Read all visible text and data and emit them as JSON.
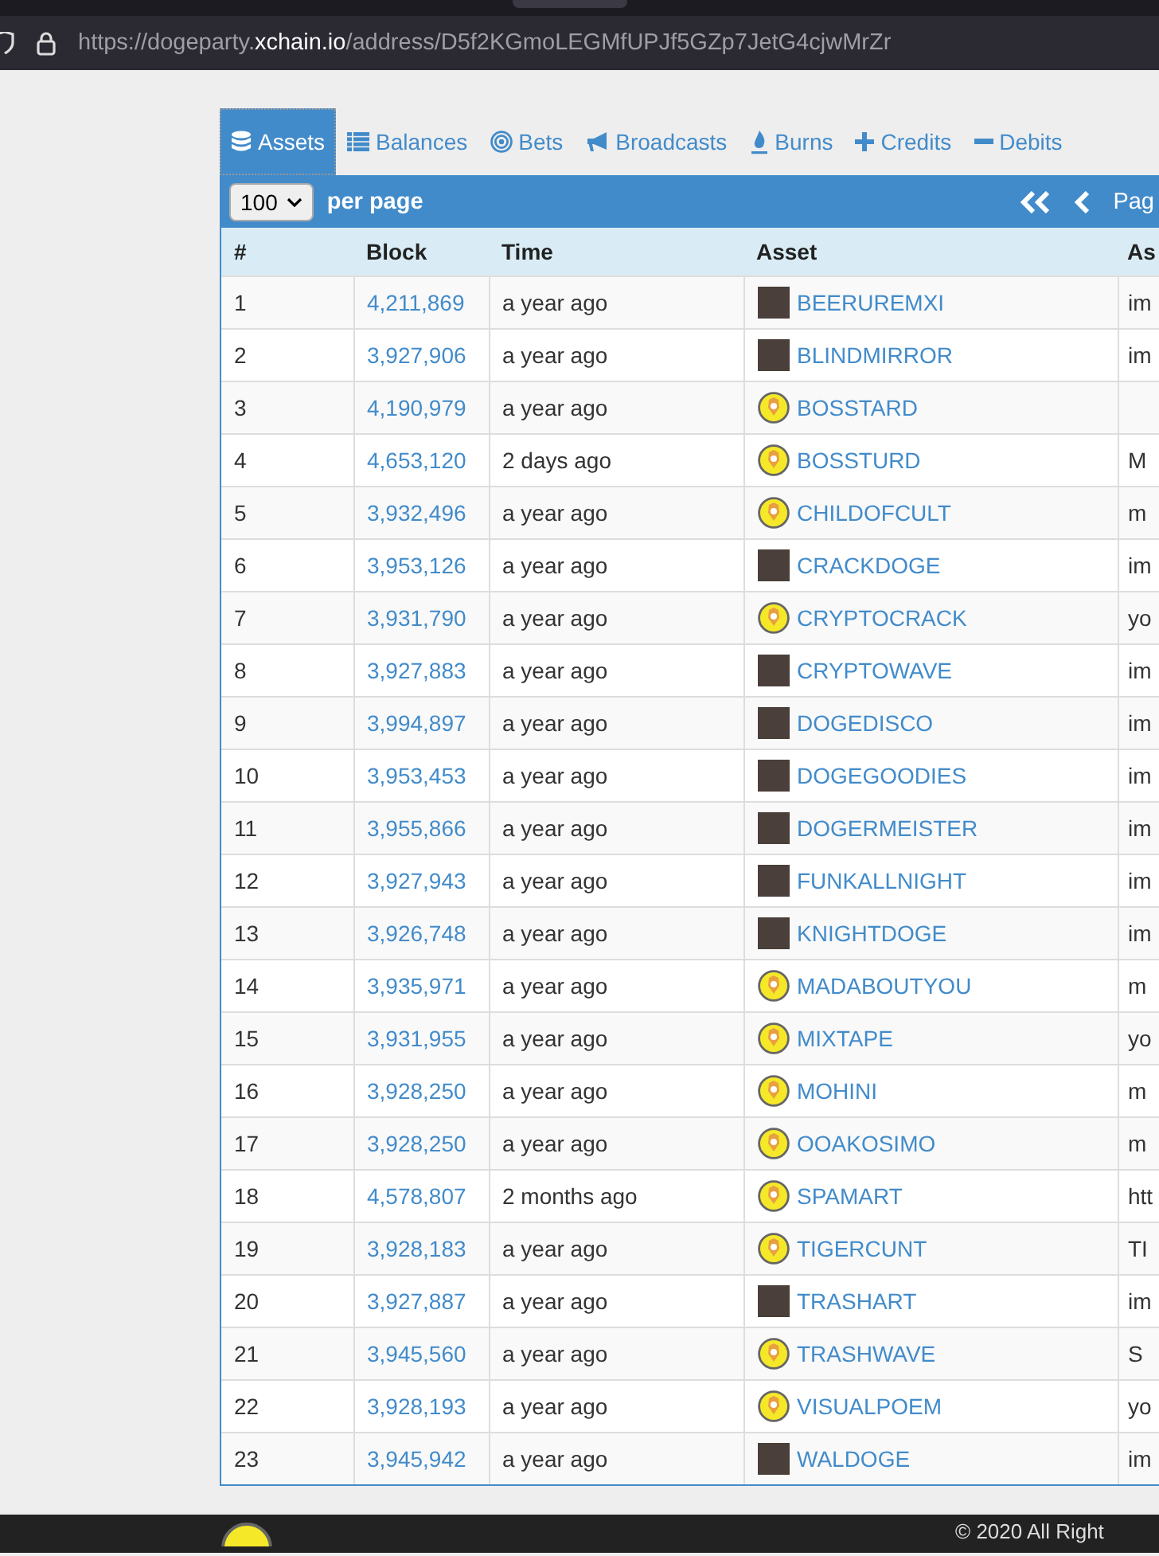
{
  "browser": {
    "url_host_prefix": "https://dogeparty.",
    "url_host": "xchain.io",
    "url_path": "/address/D5f2KGmoLEGMfUPJf5GZp7JetG4cjwMrZr"
  },
  "tabs": [
    {
      "label": "Assets",
      "kind": "database",
      "selected": true
    },
    {
      "label": "Balances",
      "kind": "list",
      "selected": false
    },
    {
      "label": "Bets",
      "kind": "target",
      "selected": false
    },
    {
      "label": "Broadcasts",
      "kind": "megaphone",
      "selected": false
    },
    {
      "label": "Burns",
      "kind": "fire",
      "selected": false
    },
    {
      "label": "Credits",
      "kind": "plus",
      "selected": false
    },
    {
      "label": "Debits",
      "kind": "minus",
      "selected": false
    }
  ],
  "toolbar": {
    "per_page_value": "100",
    "per_page_label": "per page",
    "page_label": "Pag"
  },
  "table": {
    "columns": [
      "#",
      "Block",
      "Time",
      "Asset",
      "As"
    ],
    "rows": [
      {
        "n": "1",
        "block": "4,211,869",
        "time": "a year ago",
        "asset": "BEERUREMXI",
        "kind": "image",
        "column_5": "im"
      },
      {
        "n": "2",
        "block": "3,927,906",
        "time": "a year ago",
        "asset": "BLINDMIRROR",
        "kind": "image",
        "column_5": "im"
      },
      {
        "n": "3",
        "block": "4,190,979",
        "time": "a year ago",
        "asset": "BOSSTARD",
        "kind": "coin"
      },
      {
        "n": "4",
        "block": "4,653,120",
        "time": "2 days ago",
        "asset": "BOSSTURD",
        "kind": "coin",
        "column_5": "M"
      },
      {
        "n": "5",
        "block": "3,932,496",
        "time": "a year ago",
        "asset": "CHILDOFCULT",
        "kind": "coin",
        "column_5": "m"
      },
      {
        "n": "6",
        "block": "3,953,126",
        "time": "a year ago",
        "asset": "CRACKDOGE",
        "kind": "image",
        "column_5": "im"
      },
      {
        "n": "7",
        "block": "3,931,790",
        "time": "a year ago",
        "asset": "CRYPTOCRACK",
        "kind": "coin",
        "column_5": "yo"
      },
      {
        "n": "8",
        "block": "3,927,883",
        "time": "a year ago",
        "asset": "CRYPTOWAVE",
        "kind": "image",
        "column_5": "im"
      },
      {
        "n": "9",
        "block": "3,994,897",
        "time": "a year ago",
        "asset": "DOGEDISCO",
        "kind": "image",
        "column_5": "im"
      },
      {
        "n": "10",
        "block": "3,953,453",
        "time": "a year ago",
        "asset": "DOGEGOODIES",
        "kind": "image",
        "column_5": "im"
      },
      {
        "n": "11",
        "block": "3,955,866",
        "time": "a year ago",
        "asset": "DOGERMEISTER",
        "kind": "image",
        "column_5": "im"
      },
      {
        "n": "12",
        "block": "3,927,943",
        "time": "a year ago",
        "asset": "FUNKALLNIGHT",
        "kind": "image",
        "column_5": "im"
      },
      {
        "n": "13",
        "block": "3,926,748",
        "time": "a year ago",
        "asset": "KNIGHTDOGE",
        "kind": "image",
        "column_5": "im"
      },
      {
        "n": "14",
        "block": "3,935,971",
        "time": "a year ago",
        "asset": "MADABOUTYOU",
        "kind": "coin",
        "column_5": "m"
      },
      {
        "n": "15",
        "block": "3,931,955",
        "time": "a year ago",
        "asset": "MIXTAPE",
        "kind": "coin",
        "column_5": "yo"
      },
      {
        "n": "16",
        "block": "3,928,250",
        "time": "a year ago",
        "asset": "MOHINI",
        "kind": "coin",
        "column_5": "m"
      },
      {
        "n": "17",
        "block": "3,928,250",
        "time": "a year ago",
        "asset": "OOAKOSIMO",
        "kind": "coin",
        "column_5": "m"
      },
      {
        "n": "18",
        "block": "4,578,807",
        "time": "2 months ago",
        "asset": "SPAMART",
        "kind": "coin",
        "column_5": "htt"
      },
      {
        "n": "19",
        "block": "3,928,183",
        "time": "a year ago",
        "asset": "TIGERCUNT",
        "kind": "coin",
        "column_5": "TI"
      },
      {
        "n": "20",
        "block": "3,927,887",
        "time": "a year ago",
        "asset": "TRASHART",
        "kind": "image",
        "column_5": "im"
      },
      {
        "n": "21",
        "block": "3,945,560",
        "time": "a year ago",
        "asset": "TRASHWAVE",
        "kind": "coin",
        "column_5": "S"
      },
      {
        "n": "22",
        "block": "3,928,193",
        "time": "a year ago",
        "asset": "VISUALPOEM",
        "kind": "coin",
        "column_5": "yo"
      },
      {
        "n": "23",
        "block": "3,945,942",
        "time": "a year ago",
        "asset": "WALDOGE",
        "kind": "image",
        "column_5": "im"
      }
    ]
  },
  "footer": {
    "copyright": "© 2020 All Right"
  }
}
